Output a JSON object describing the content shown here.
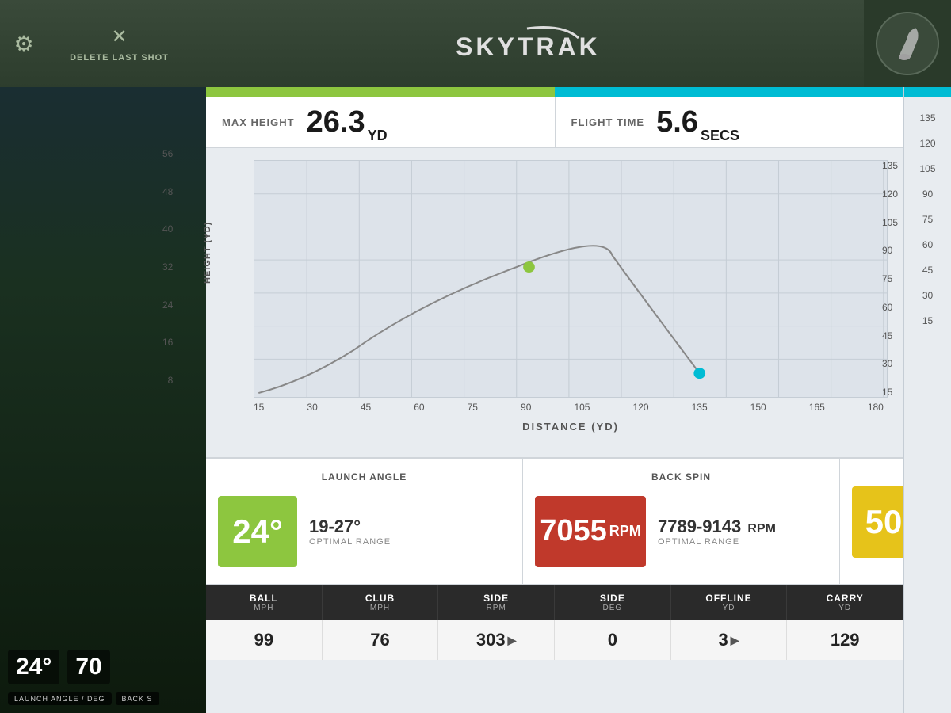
{
  "header": {
    "delete_label": "DELETE LAST SHOT",
    "logo_text": "SKYTRAK"
  },
  "stats": {
    "max_height_label": "MAX HEIGHT",
    "max_height_value": "26.3",
    "max_height_unit": "YD",
    "flight_time_label": "FLIGHT TIME",
    "flight_time_value": "5.6",
    "flight_time_unit": "SECS"
  },
  "chart": {
    "y_axis_labels": [
      "56",
      "48",
      "40",
      "32",
      "24",
      "16",
      "8"
    ],
    "x_axis_labels": [
      "15",
      "30",
      "45",
      "60",
      "75",
      "90",
      "105",
      "120",
      "135",
      "150",
      "165",
      "180"
    ],
    "y_axis_title": "HEIGHT (YD)",
    "x_axis_title": "DISTANCE (YD)",
    "right_axis_labels": [
      "135",
      "120",
      "105",
      "90",
      "75",
      "60",
      "45",
      "30",
      "15"
    ],
    "right_axis_title": "DISTANCE (YD)"
  },
  "launch_angle": {
    "title": "LAUNCH ANGLE",
    "value": "24°",
    "optimal_range": "19-27°",
    "optimal_label": "OPTIMAL RANGE"
  },
  "back_spin": {
    "title": "BACK SPIN",
    "value": "7055",
    "unit": "RPM",
    "optimal_range": "7789-9143",
    "optimal_unit": "RPM",
    "optimal_label": "OPTIMAL RANGE"
  },
  "third_metric": {
    "value": "50"
  },
  "table": {
    "headers": [
      {
        "main": "BALL",
        "sub": "MPH"
      },
      {
        "main": "CLUB",
        "sub": "MPH"
      },
      {
        "main": "SIDE",
        "sub": "RPM"
      },
      {
        "main": "SIDE",
        "sub": "DEG"
      },
      {
        "main": "OFFLINE",
        "sub": "YD"
      },
      {
        "main": "CARRY",
        "sub": "YD"
      }
    ],
    "values": [
      "99",
      "76",
      "303",
      "0",
      "3",
      "129"
    ],
    "arrows": [
      false,
      false,
      true,
      false,
      true,
      false
    ]
  },
  "left_panel": {
    "angle_value": "24°",
    "spin_value": "70",
    "bottom_labels": [
      "LAUNCH ANGLE / DEG",
      "BACK S"
    ]
  }
}
